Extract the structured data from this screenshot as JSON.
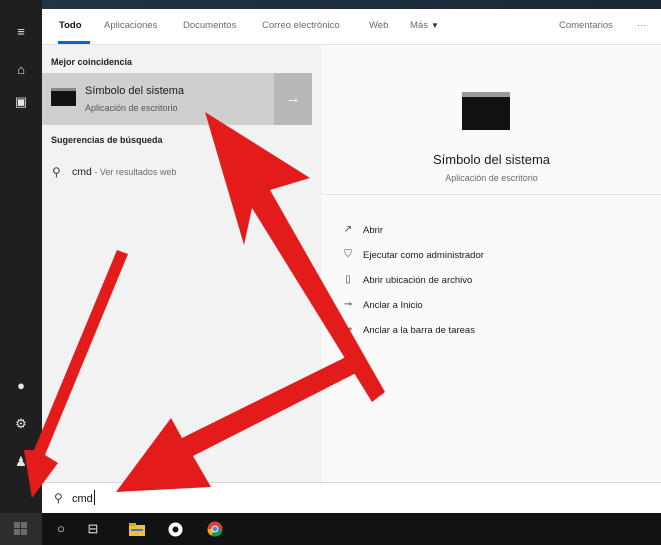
{
  "tabs": [
    {
      "label": "Todo",
      "active": true
    },
    {
      "label": "Aplicaciones"
    },
    {
      "label": "Documentos"
    },
    {
      "label": "Correo electrónico"
    },
    {
      "label": "Web"
    },
    {
      "label": "Más"
    },
    {
      "label": "Comentarios"
    },
    {
      "label": "···"
    }
  ],
  "results": {
    "best_match_header": "Mejor coincidencia",
    "best_match": {
      "title": "Símbolo del sistema",
      "subtitle": "Aplicación de escritorio",
      "open_arrow": "→"
    },
    "suggestions_header": "Sugerencias de búsqueda",
    "suggestion": {
      "query": "cmd",
      "suffix": " - Ver resultados web",
      "chevron": "›"
    }
  },
  "detail": {
    "title": "Símbolo del sistema",
    "subtitle": "Aplicación de escritorio",
    "actions": [
      {
        "label": "Abrir",
        "icon": "open-icon"
      },
      {
        "label": "Ejecutar como administrador",
        "icon": "shield-run-icon"
      },
      {
        "label": "Abrir ubicación de archivo",
        "icon": "file-location-icon"
      },
      {
        "label": "Anclar a Inicio",
        "icon": "pin-icon"
      },
      {
        "label": "Anclar a la barra de tareas",
        "icon": "taskbar-pin-icon"
      }
    ]
  },
  "search": {
    "value": "cmd"
  },
  "colors": {
    "accent": "#0b63c4",
    "arrow": "#e31b1b",
    "selected_row": "#cfcfcf"
  }
}
